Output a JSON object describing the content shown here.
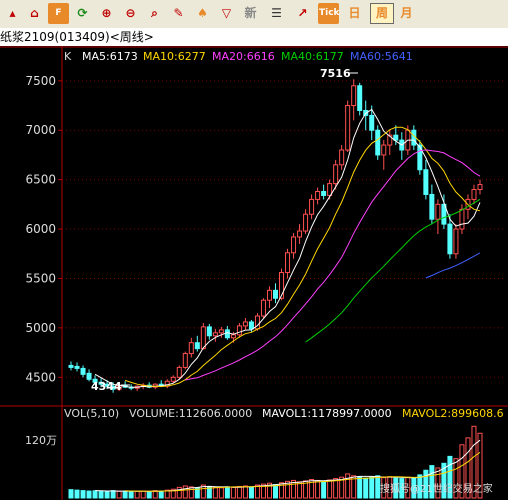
{
  "toolbar": {
    "buttons": [
      {
        "icon": "up-icon",
        "glyph": "▴",
        "color": "#c00000"
      },
      {
        "icon": "home-icon",
        "glyph": "⌂",
        "color": "#c00000"
      },
      {
        "icon": "f10-icon",
        "glyph": "F",
        "color": "#e8892a"
      },
      {
        "icon": "refresh-icon",
        "glyph": "⟳",
        "color": "#1a8a1a"
      },
      {
        "icon": "zoom-in-icon",
        "glyph": "⊕",
        "color": "#c00000"
      },
      {
        "icon": "zoom-out-icon",
        "glyph": "⊖",
        "color": "#c00000"
      },
      {
        "icon": "search-icon",
        "glyph": "⌕",
        "color": "#c00000"
      },
      {
        "icon": "draw-icon",
        "glyph": "✎",
        "color": "#c00000"
      },
      {
        "icon": "bell-icon",
        "glyph": "♠",
        "color": "#e8892a"
      },
      {
        "icon": "filter-icon",
        "glyph": "▽",
        "color": "#c00000"
      },
      {
        "icon": "news-icon",
        "glyph": "新",
        "color": "#888"
      },
      {
        "icon": "list-icon",
        "glyph": "☰",
        "color": "#333"
      },
      {
        "icon": "trend-icon",
        "glyph": "↗",
        "color": "#c00000"
      },
      {
        "icon": "tick-icon",
        "glyph": "Tick",
        "color": "#e8892a"
      },
      {
        "icon": "day-icon",
        "glyph": "日",
        "color": "#e8892a"
      },
      {
        "icon": "week-icon",
        "glyph": "周",
        "color": "#e8892a"
      },
      {
        "icon": "month-icon",
        "glyph": "月",
        "color": "#e8892a"
      }
    ]
  },
  "title": "纸浆2109(013409)<周线>",
  "legend": {
    "k": "K",
    "ma5": "MA5:6173",
    "ma10": "MA10:6277",
    "ma20": "MA20:6616",
    "ma40": "MA40:6177",
    "ma60": "MA60:5641",
    "peak": "7516",
    "low": "4344"
  },
  "volume_legend": {
    "vol": "VOL(5,10)",
    "volume": "VOLUME:112606.0000",
    "mavol1": "MAVOL1:1178997.0000",
    "mavol2": "MAVOL2:899608.6"
  },
  "volume_axis": "120万",
  "watermark": "搜狐号@21世纪交易之家",
  "colors": {
    "up": "#ff5050",
    "down": "#54ffff",
    "ma5": "#ffffff",
    "ma10": "#ffd700",
    "ma20": "#ff40ff",
    "ma40": "#00d000",
    "ma60": "#4060ff",
    "frame": "#b00000"
  },
  "chart_data": {
    "type": "candlestick",
    "y_ticks": [
      4500,
      5000,
      5500,
      6000,
      6500,
      7000,
      7500
    ],
    "ylim": [
      4250,
      7650
    ],
    "candles": [
      [
        4620,
        4660,
        4570,
        4600
      ],
      [
        4610,
        4650,
        4560,
        4590
      ],
      [
        4590,
        4620,
        4500,
        4530
      ],
      [
        4540,
        4580,
        4460,
        4480
      ],
      [
        4480,
        4520,
        4420,
        4450
      ],
      [
        4450,
        4490,
        4400,
        4430
      ],
      [
        4430,
        4470,
        4380,
        4410
      ],
      [
        4410,
        4450,
        4344,
        4380
      ],
      [
        4380,
        4440,
        4360,
        4420
      ],
      [
        4420,
        4460,
        4390,
        4400
      ],
      [
        4400,
        4430,
        4370,
        4390
      ],
      [
        4390,
        4420,
        4360,
        4410
      ],
      [
        4410,
        4440,
        4380,
        4420
      ],
      [
        4420,
        4450,
        4390,
        4400
      ],
      [
        4400,
        4440,
        4380,
        4430
      ],
      [
        4430,
        4470,
        4400,
        4410
      ],
      [
        4410,
        4480,
        4390,
        4460
      ],
      [
        4460,
        4520,
        4440,
        4500
      ],
      [
        4500,
        4620,
        4480,
        4600
      ],
      [
        4600,
        4760,
        4580,
        4740
      ],
      [
        4740,
        4900,
        4700,
        4850
      ],
      [
        4850,
        4920,
        4760,
        4790
      ],
      [
        4790,
        5050,
        4780,
        5010
      ],
      [
        5010,
        5040,
        4880,
        4920
      ],
      [
        4920,
        4990,
        4860,
        4950
      ],
      [
        4950,
        5010,
        4900,
        4980
      ],
      [
        4980,
        5020,
        4880,
        4900
      ],
      [
        4900,
        4960,
        4850,
        4930
      ],
      [
        4930,
        5050,
        4900,
        5020
      ],
      [
        5020,
        5100,
        4980,
        5060
      ],
      [
        5060,
        5080,
        4960,
        4990
      ],
      [
        4990,
        5150,
        4970,
        5120
      ],
      [
        5120,
        5300,
        5100,
        5280
      ],
      [
        5280,
        5420,
        5200,
        5380
      ],
      [
        5380,
        5450,
        5250,
        5300
      ],
      [
        5300,
        5600,
        5280,
        5560
      ],
      [
        5560,
        5800,
        5500,
        5760
      ],
      [
        5760,
        5960,
        5700,
        5920
      ],
      [
        5920,
        6050,
        5850,
        5980
      ],
      [
        5980,
        6200,
        5950,
        6150
      ],
      [
        6150,
        6350,
        6100,
        6300
      ],
      [
        6300,
        6420,
        6250,
        6380
      ],
      [
        6380,
        6450,
        6300,
        6340
      ],
      [
        6340,
        6500,
        6300,
        6460
      ],
      [
        6460,
        6700,
        6400,
        6650
      ],
      [
        6650,
        6850,
        6600,
        6800
      ],
      [
        6800,
        7300,
        6780,
        7250
      ],
      [
        7250,
        7516,
        7100,
        7450
      ],
      [
        7450,
        7480,
        7150,
        7200
      ],
      [
        7200,
        7300,
        7000,
        7150
      ],
      [
        7150,
        7250,
        6900,
        7000
      ],
      [
        7000,
        7050,
        6700,
        6750
      ],
      [
        6750,
        6900,
        6600,
        6850
      ],
      [
        6850,
        7000,
        6750,
        6950
      ],
      [
        6950,
        7050,
        6850,
        6900
      ],
      [
        6900,
        6980,
        6700,
        6800
      ],
      [
        6800,
        7050,
        6750,
        7000
      ],
      [
        7000,
        7050,
        6800,
        6850
      ],
      [
        6850,
        6900,
        6550,
        6600
      ],
      [
        6600,
        6700,
        6300,
        6350
      ],
      [
        6350,
        6450,
        6050,
        6100
      ],
      [
        6100,
        6300,
        5950,
        6250
      ],
      [
        6250,
        6350,
        6000,
        6050
      ],
      [
        6050,
        6150,
        5700,
        5750
      ],
      [
        5750,
        6050,
        5700,
        6000
      ],
      [
        6000,
        6250,
        5950,
        6200
      ],
      [
        6200,
        6350,
        6100,
        6300
      ],
      [
        6300,
        6450,
        6250,
        6400
      ],
      [
        6400,
        6500,
        6350,
        6450
      ]
    ],
    "volumes": [
      180000,
      170000,
      160000,
      150000,
      155000,
      140000,
      150000,
      160000,
      145000,
      150000,
      140000,
      145000,
      150000,
      140000,
      160000,
      150000,
      170000,
      190000,
      230000,
      260000,
      240000,
      220000,
      280000,
      250000,
      230000,
      220000,
      240000,
      230000,
      250000,
      260000,
      240000,
      280000,
      300000,
      320000,
      290000,
      330000,
      360000,
      380000,
      350000,
      370000,
      400000,
      380000,
      360000,
      390000,
      420000,
      450000,
      520000,
      480000,
      460000,
      430000,
      450000,
      480000,
      440000,
      460000,
      430000,
      420000,
      450000,
      430000,
      500000,
      600000,
      700000,
      650000,
      750000,
      900000,
      850000,
      1150000,
      1300000,
      1550000,
      1400000
    ]
  }
}
